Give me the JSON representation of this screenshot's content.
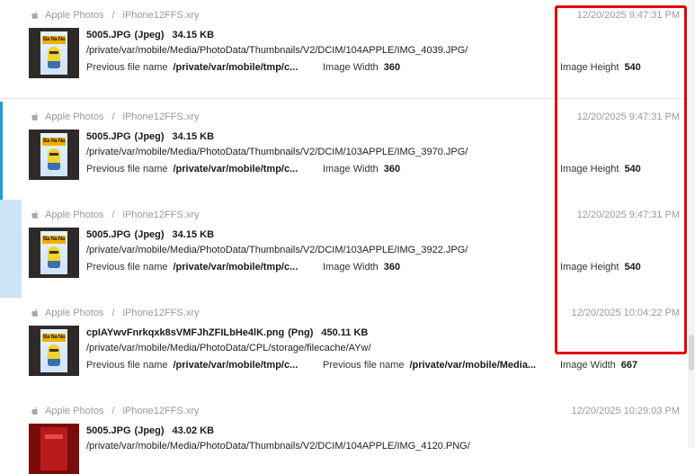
{
  "highlight": {
    "color": "#e30000"
  },
  "accent": {
    "selected_bar": "#1aa0d8",
    "hover_fill": "#cde3f6"
  },
  "rows": [
    {
      "source": "Apple Photos",
      "device": "iPhone12FFS.xry",
      "timestamp": "12/20/2025 9:47:31 PM",
      "filename": "5005.JPG",
      "filetype": "(Jpeg)",
      "filesize": "34.15 KB",
      "path": "/private/var/mobile/Media/PhotoData/Thumbnails/V2/DCIM/104APPLE/IMG_4039.JPG/",
      "attrs": [
        {
          "label": "Previous file name",
          "value": "/private/var/mobile/tmp/c..."
        },
        {
          "label": "Image Width",
          "value": "360"
        },
        {
          "label": "Image Height",
          "value": "540"
        }
      ]
    },
    {
      "source": "Apple Photos",
      "device": "iPhone12FFS.xry",
      "timestamp": "12/20/2025 9:47:31 PM",
      "filename": "5005.JPG",
      "filetype": "(Jpeg)",
      "filesize": "34.15 KB",
      "path": "/private/var/mobile/Media/PhotoData/Thumbnails/V2/DCIM/103APPLE/IMG_3970.JPG/",
      "attrs": [
        {
          "label": "Previous file name",
          "value": "/private/var/mobile/tmp/c..."
        },
        {
          "label": "Image Width",
          "value": "360"
        },
        {
          "label": "Image Height",
          "value": "540"
        }
      ]
    },
    {
      "source": "Apple Photos",
      "device": "iPhone12FFS.xry",
      "timestamp": "12/20/2025 9:47:31 PM",
      "filename": "5005.JPG",
      "filetype": "(Jpeg)",
      "filesize": "34.15 KB",
      "path": "/private/var/mobile/Media/PhotoData/Thumbnails/V2/DCIM/103APPLE/IMG_3922.JPG/",
      "attrs": [
        {
          "label": "Previous file name",
          "value": "/private/var/mobile/tmp/c..."
        },
        {
          "label": "Image Width",
          "value": "360"
        },
        {
          "label": "Image Height",
          "value": "540"
        }
      ]
    },
    {
      "source": "Apple Photos",
      "device": "iPhone12FFS.xry",
      "timestamp": "12/20/2025 10:04:22 PM",
      "filename": "cpIAYwvFnrkqxk8sVMFJhZFILbHe4lK.png",
      "filetype": "(Png)",
      "filesize": "450.11 KB",
      "path": "/private/var/mobile/Media/PhotoData/CPL/storage/filecache/AYw/",
      "attrs": [
        {
          "label": "Previous file name",
          "value": "/private/var/mobile/tmp/c..."
        },
        {
          "label": "Previous file name",
          "value": "/private/var/mobile/Media..."
        },
        {
          "label": "Image Width",
          "value": "667"
        }
      ]
    },
    {
      "source": "Apple Photos",
      "device": "iPhone12FFS.xry",
      "timestamp": "12/20/2025 10:29:03 PM",
      "filename": "5005.JPG",
      "filetype": "(Jpeg)",
      "filesize": "43.02 KB",
      "path": "/private/var/mobile/Media/PhotoData/Thumbnails/V2/DCIM/104APPLE/IMG_4120.PNG/"
    }
  ],
  "thumbnail_text": "Ba Na Na",
  "icons": {
    "source": "apple-icon"
  }
}
